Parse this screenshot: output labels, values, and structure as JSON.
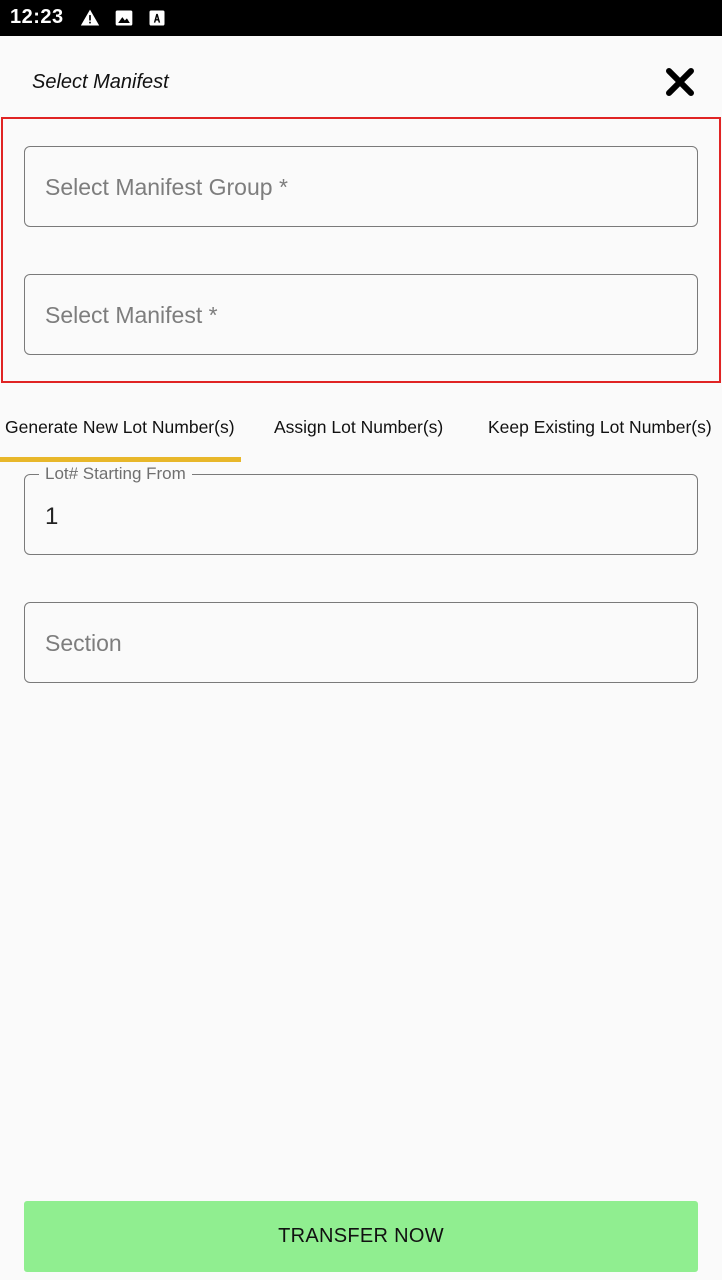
{
  "status_bar": {
    "time": "12:23",
    "icons": [
      "warning-icon",
      "image-icon",
      "font-download-icon"
    ]
  },
  "header": {
    "title": "Select Manifest",
    "close_icon": "close-icon"
  },
  "form": {
    "manifest_group": {
      "placeholder": "Select Manifest Group *"
    },
    "manifest": {
      "placeholder": "Select Manifest *"
    },
    "lot_start": {
      "label": "Lot# Starting From",
      "value": "1"
    },
    "section": {
      "placeholder": "Section"
    }
  },
  "tabs": [
    {
      "label": "Generate New Lot Number(s)",
      "selected": true
    },
    {
      "label": "Assign Lot Number(s)",
      "selected": false
    },
    {
      "label": "Keep Existing Lot Number(s)",
      "selected": false
    }
  ],
  "actions": {
    "transfer_label": "TRANSFER NOW"
  },
  "colors": {
    "highlight_border": "#e02424",
    "tab_indicator": "#e8b72a",
    "transfer_button": "#90ee90",
    "status_bar": "#000000"
  }
}
